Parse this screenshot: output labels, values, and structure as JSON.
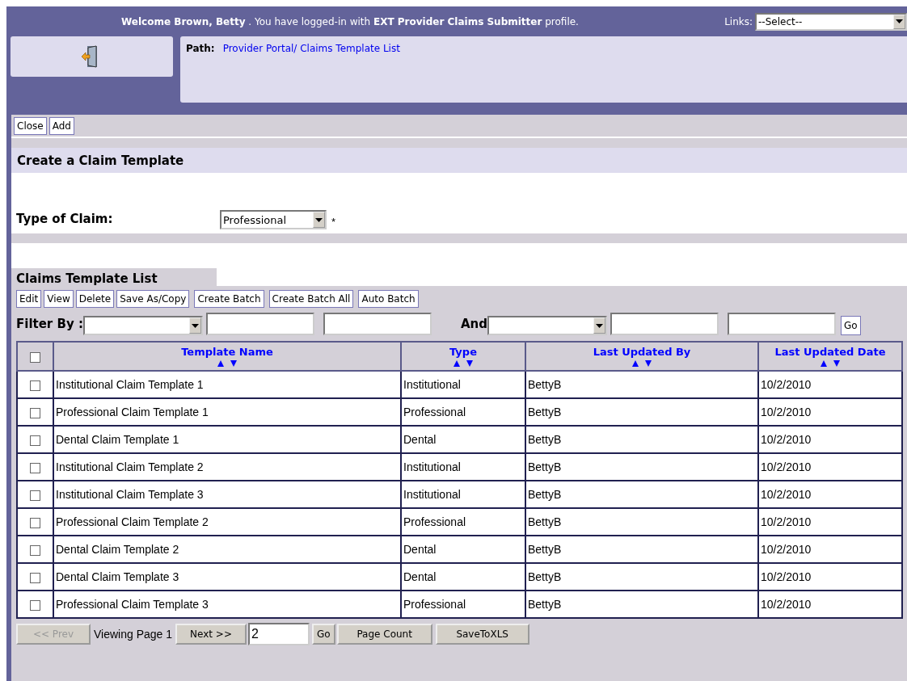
{
  "header": {
    "welcome": "Welcome Brown, Betty",
    "text_1": ". You have logged-in with",
    "profile": "EXT Provider Claims Submitter",
    "text_2": "profile.",
    "links_label": "Links:",
    "links_value": "--Select--"
  },
  "path": {
    "label": "Path:",
    "value": "Provider Portal/ Claims Template List"
  },
  "toolbar": [
    "Close",
    "Add"
  ],
  "create_section": {
    "title": "Create a Claim Template",
    "type_label": "Type of Claim:",
    "type_value": "Professional",
    "required_mark": "*"
  },
  "list": {
    "title": "Claims Template List",
    "actions": [
      "Edit",
      "View",
      "Delete",
      "Save As/Copy",
      "Create Batch",
      "Create Batch All",
      "Auto Batch"
    ],
    "filter": {
      "label": "Filter By :",
      "and_label": "And",
      "go": "Go"
    },
    "columns": [
      "Template Name",
      "Type",
      "Last Updated By",
      "Last Updated Date"
    ],
    "select_all": {
      "checked": false
    },
    "rows": [
      {
        "checked": false,
        "cells": [
          "Institutional Claim Template 1",
          "Institutional",
          "BettyB",
          "10/2/2010"
        ]
      },
      {
        "checked": false,
        "cells": [
          "Professional Claim Template 1",
          "Professional",
          "BettyB",
          "10/2/2010"
        ]
      },
      {
        "checked": false,
        "cells": [
          "Dental Claim Template 1",
          "Dental",
          "BettyB",
          "10/2/2010"
        ]
      },
      {
        "checked": false,
        "cells": [
          "Institutional Claim Template 2",
          "Institutional",
          "BettyB",
          "10/2/2010"
        ]
      },
      {
        "checked": false,
        "cells": [
          "Institutional Claim Template 3",
          "Institutional",
          "BettyB",
          "10/2/2010"
        ]
      },
      {
        "checked": false,
        "cells": [
          "Professional Claim Template 2",
          "Professional",
          "BettyB",
          "10/2/2010"
        ]
      },
      {
        "checked": false,
        "cells": [
          "Dental Claim Template 2",
          "Dental",
          "BettyB",
          "10/2/2010"
        ]
      },
      {
        "checked": false,
        "cells": [
          "Dental Claim Template 3",
          "Dental",
          "BettyB",
          "10/2/2010"
        ]
      },
      {
        "checked": false,
        "cells": [
          "Professional Claim Template 3",
          "Professional",
          "BettyB",
          "10/2/2010"
        ]
      }
    ]
  },
  "pager": {
    "prev": {
      "label": "<< Prev",
      "disabled": true
    },
    "viewing": "Viewing Page 1",
    "next": {
      "label": "Next >>",
      "disabled": false
    },
    "page_value": "2",
    "go": "Go",
    "page_count": "Page Count",
    "export": "SaveToXLS"
  }
}
